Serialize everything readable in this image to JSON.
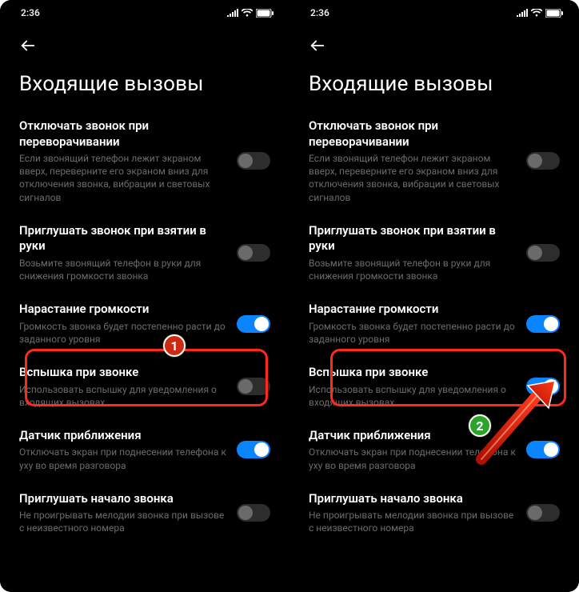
{
  "statusbar": {
    "time": "2:36"
  },
  "header": {
    "title": "Входящие вызовы"
  },
  "settings": [
    {
      "key": "flip_to_silence",
      "title": "Отключать звонок при переворачивании",
      "desc": "Если звонящий телефон лежит экраном вверх, переверните его экраном вниз для отключения звонка, вибрации и световых сигналов",
      "left_on": false,
      "right_on": false
    },
    {
      "key": "pickup_quiet",
      "title": "Приглушать звонок при взятии в руки",
      "desc": "Возьмите звонящий телефон в руки для снижения громкости звонка",
      "left_on": false,
      "right_on": false
    },
    {
      "key": "ascending_volume",
      "title": "Нарастание громкости",
      "desc": "Громкость звонка будет постепенно расти до заданного уровня",
      "left_on": true,
      "right_on": true
    },
    {
      "key": "flash_on_call",
      "title": "Вспышка при звонке",
      "desc": "Использовать вспышку для уведомления о входящих вызовах",
      "left_on": false,
      "right_on": true
    },
    {
      "key": "proximity_sensor",
      "title": "Датчик приближения",
      "desc": "Отключать экран при поднесении телефона к уху во время разговора",
      "left_on": true,
      "right_on": true
    },
    {
      "key": "mute_start_ring",
      "title": "Приглушать начало звонка",
      "desc": "Не проигрывать мелодии звонка при вызове с неизвестного номера",
      "left_on": false,
      "right_on": false
    }
  ],
  "annotations": {
    "badge1": "1",
    "badge2": "2"
  }
}
